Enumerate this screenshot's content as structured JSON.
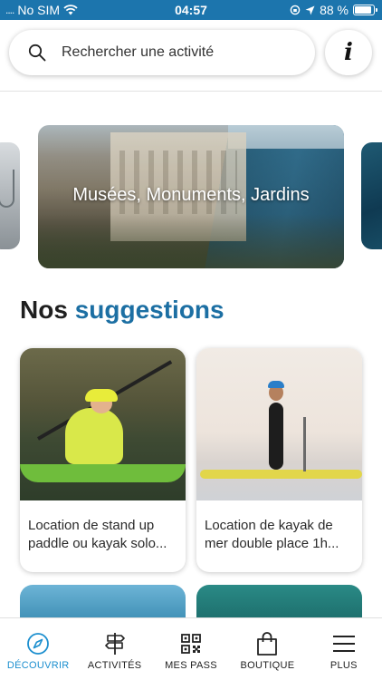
{
  "status_bar": {
    "carrier": "No SIM",
    "time": "04:57",
    "battery": "88 %",
    "battery_level": 0.88
  },
  "search": {
    "placeholder": "Rechercher une activité"
  },
  "info_button": {
    "label": "i"
  },
  "carousel": {
    "items": [
      {
        "title": "Musées, Monuments, Jardins"
      }
    ]
  },
  "section": {
    "title_prefix": "Nos",
    "title_accent": "suggestions"
  },
  "suggestions": [
    {
      "title": "Location de stand up paddle ou kayak solo..."
    },
    {
      "title": "Location de kayak de mer double place 1h..."
    }
  ],
  "tabs": [
    {
      "label": "DÉCOUVRIR",
      "icon": "compass-icon",
      "active": true
    },
    {
      "label": "ACTIVITÉS",
      "icon": "signpost-icon",
      "active": false
    },
    {
      "label": "MES PASS",
      "icon": "qr-code-icon",
      "active": false
    },
    {
      "label": "BOUTIQUE",
      "icon": "shopping-bag-icon",
      "active": false
    },
    {
      "label": "PLUS",
      "icon": "menu-icon",
      "active": false
    }
  ],
  "colors": {
    "status_bar_bg": "#1c75ad",
    "accent": "#1c6fa3",
    "active_tab": "#1c8fcf"
  }
}
